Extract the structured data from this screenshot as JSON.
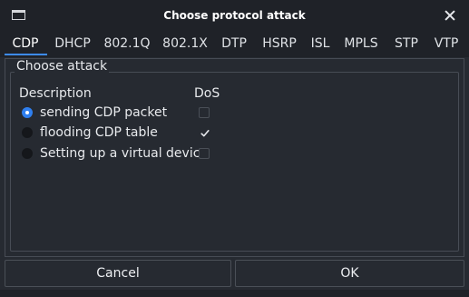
{
  "window": {
    "title": "Choose protocol attack"
  },
  "tabs": [
    {
      "label": "CDP",
      "active": true
    },
    {
      "label": "DHCP"
    },
    {
      "label": "802.1Q"
    },
    {
      "label": "802.1X"
    },
    {
      "label": "DTP"
    },
    {
      "label": "HSRP"
    },
    {
      "label": "ISL"
    },
    {
      "label": "MPLS"
    },
    {
      "label": "STP"
    },
    {
      "label": "VTP"
    }
  ],
  "group": {
    "title": "Choose attack",
    "col_description": "Description",
    "col_dos": "DoS",
    "attacks": [
      {
        "label": "sending CDP packet",
        "selected": true,
        "dos": false
      },
      {
        "label": "flooding CDP table",
        "selected": false,
        "dos": true
      },
      {
        "label": "Setting up a virtual device",
        "selected": false,
        "dos": false
      }
    ]
  },
  "buttons": {
    "cancel": "Cancel",
    "ok": "OK"
  },
  "colors": {
    "accent": "#3d8bf2",
    "background": "#262a31",
    "titlebar": "#1f2228"
  },
  "icons": {
    "window": "window-icon",
    "close": "close-icon",
    "check": "checkmark-icon"
  }
}
